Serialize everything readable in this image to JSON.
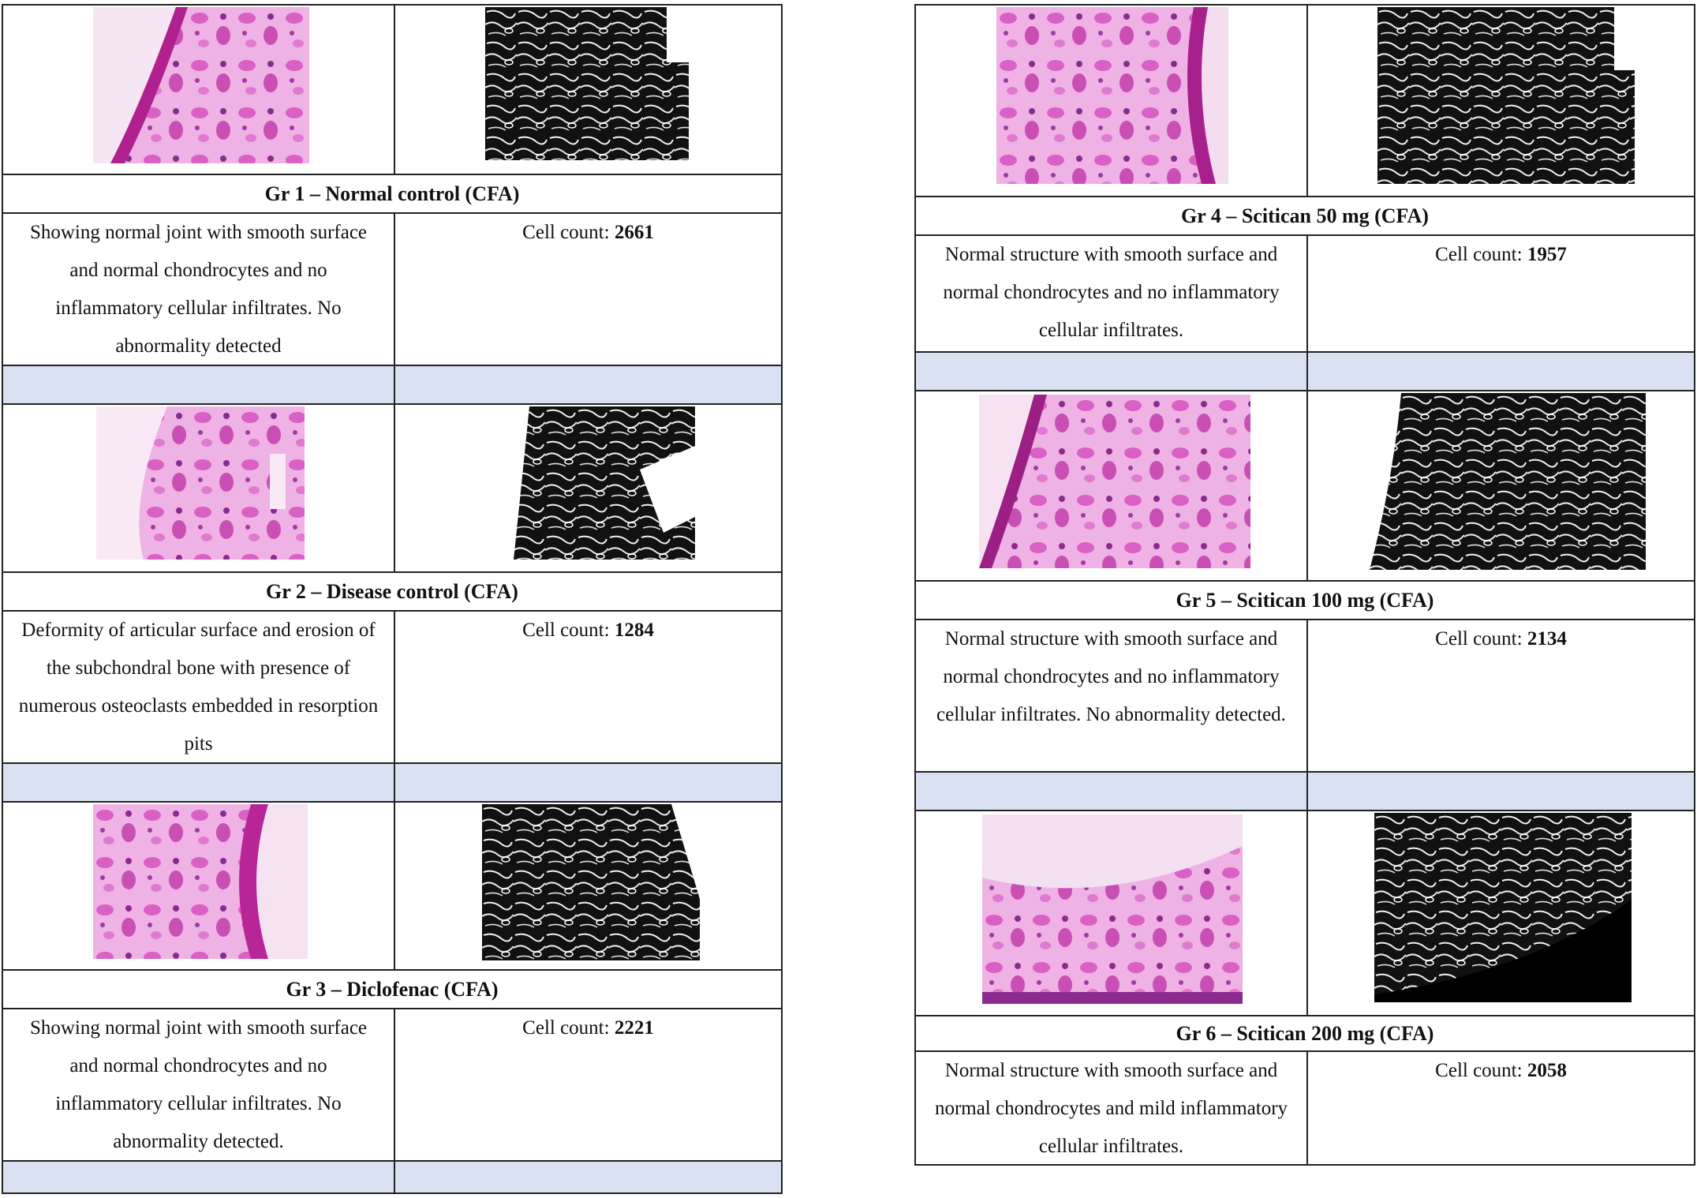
{
  "groups": [
    {
      "caption": "Gr 1 – Normal control (CFA)",
      "description": "Showing normal joint with smooth surface and normal chondrocytes and no inflammatory cellular infiltrates. No abnormality detected",
      "count_label": "Cell count: ",
      "count_value": "2661"
    },
    {
      "caption": "Gr 2 – Disease control (CFA)",
      "description": "Deformity of articular surface and erosion of the subchondral bone with presence of numerous osteoclasts embedded in resorption pits",
      "count_label": "Cell count: ",
      "count_value": "1284"
    },
    {
      "caption": "Gr 3 – Diclofenac (CFA)",
      "description": "Showing normal joint with smooth surface and normal chondrocytes and no inflammatory cellular infiltrates. No abnormality detected.",
      "count_label": "Cell count: ",
      "count_value": "2221"
    },
    {
      "caption": "Gr 4 – Scitican 50 mg (CFA)",
      "description": "Normal structure with smooth surface and normal chondrocytes and no inflammatory cellular infiltrates.",
      "count_label": "Cell count: ",
      "count_value": "1957"
    },
    {
      "caption": "Gr 5 – Scitican 100 mg (CFA)",
      "description": "Normal structure with smooth surface and normal chondrocytes and no inflammatory cellular infiltrates. No abnormality detected.",
      "count_label": "Cell count: ",
      "count_value": "2134"
    },
    {
      "caption": "Gr 6 – Scitican 200 mg (CFA)",
      "description": "Normal structure with smooth surface and normal chondrocytes and mild inflammatory cellular infiltrates.",
      "count_label": "Cell count: ",
      "count_value": "2058"
    }
  ],
  "colors": {
    "shade": "#d9e1f2",
    "stain_pink": "#d85bbf",
    "stain_purple": "#8a2b8f",
    "border": "#222222"
  }
}
